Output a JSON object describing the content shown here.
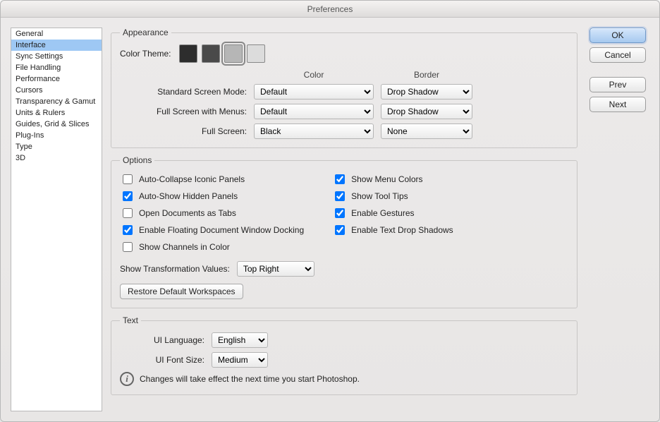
{
  "window": {
    "title": "Preferences"
  },
  "buttons": {
    "ok": "OK",
    "cancel": "Cancel",
    "prev": "Prev",
    "next": "Next"
  },
  "sidebar": {
    "items": [
      {
        "label": "General"
      },
      {
        "label": "Interface"
      },
      {
        "label": "Sync Settings"
      },
      {
        "label": "File Handling"
      },
      {
        "label": "Performance"
      },
      {
        "label": "Cursors"
      },
      {
        "label": "Transparency & Gamut"
      },
      {
        "label": "Units & Rulers"
      },
      {
        "label": "Guides, Grid & Slices"
      },
      {
        "label": "Plug-Ins"
      },
      {
        "label": "Type"
      },
      {
        "label": "3D"
      }
    ],
    "selectedIndex": 1
  },
  "appearance": {
    "legend": "Appearance",
    "color_theme_label": "Color Theme:",
    "swatches": [
      "#2d2d2d",
      "#4a4a4a",
      "#b6b6b6",
      "#dcdcdc"
    ],
    "selectedSwatch": 2,
    "headers": {
      "color": "Color",
      "border": "Border"
    },
    "rows": [
      {
        "label": "Standard Screen Mode:",
        "color": "Default",
        "border": "Drop Shadow"
      },
      {
        "label": "Full Screen with Menus:",
        "color": "Default",
        "border": "Drop Shadow"
      },
      {
        "label": "Full Screen:",
        "color": "Black",
        "border": "None"
      }
    ]
  },
  "options": {
    "legend": "Options",
    "left": [
      {
        "label": "Auto-Collapse Iconic Panels",
        "checked": false
      },
      {
        "label": "Auto-Show Hidden Panels",
        "checked": true
      },
      {
        "label": "Open Documents as Tabs",
        "checked": false
      },
      {
        "label": "Enable Floating Document Window Docking",
        "checked": true
      },
      {
        "label": "Show Channels in Color",
        "checked": false
      }
    ],
    "right": [
      {
        "label": "Show Menu Colors",
        "checked": true
      },
      {
        "label": "Show Tool Tips",
        "checked": true
      },
      {
        "label": "Enable Gestures",
        "checked": true
      },
      {
        "label": "Enable Text Drop Shadows",
        "checked": true
      }
    ],
    "transform_label": "Show Transformation Values:",
    "transform_value": "Top Right",
    "restore_label": "Restore Default Workspaces"
  },
  "text": {
    "legend": "Text",
    "language_label": "UI Language:",
    "language_value": "English",
    "fontsize_label": "UI Font Size:",
    "fontsize_value": "Medium",
    "info": "Changes will take effect the next time you start Photoshop."
  }
}
